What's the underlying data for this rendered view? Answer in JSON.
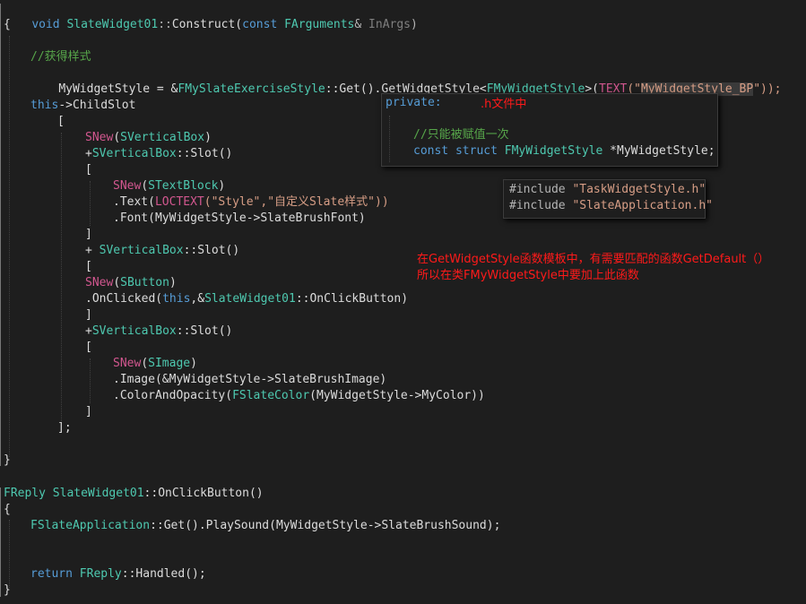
{
  "code": {
    "l1_void": "void",
    "l1_class": "SlateWidget01",
    "l1_sep": "::",
    "l1_fn": "Construct(",
    "l1_const": "const",
    "l1_type": "FArguments",
    "l1_amp": "&",
    "l1_param": "InArgs",
    "l1_close": ")",
    "brace_open": "{",
    "brace_close": "}",
    "comment_style": "//获得样式",
    "l4_var": "MyWidgetStyle = &",
    "l4_cls": "FMySlateExerciseStyle",
    "l4_mid": "::Get().GetWidgetStyle<",
    "l4_tmpl": "FMyWidgetStyle",
    "l4_open": ">(",
    "l4_macro": "TEXT",
    "l4_str_pre": "(\"",
    "l4_str": "MyWidgetStyle_BP",
    "l4_str_post": "\"));",
    "l6_this": "this",
    "l6_rest": "->ChildSlot",
    "bracket_open": "[",
    "bracket_close": "]",
    "bracket_end": "];",
    "snew": "SNew",
    "svb": "SVerticalBox",
    "plus": "+",
    "plus_sp": "+ ",
    "slot": "::Slot()",
    "stextblock": "STextBlock",
    "text_call": ".Text(",
    "loctext": "LOCTEXT",
    "loctext_args": "(\"Style\",\"自定义Slate样式\"))",
    "font_call": ".Font(MyWidgetStyle->SlateBrushFont)",
    "sbutton": "SButton",
    "onclicked": ".OnClicked(",
    "onclicked_this": "this",
    "onclicked_mid": ",&",
    "onclicked_cls": "SlateWidget01",
    "onclicked_end": "::OnClickButton)",
    "simage": "SImage",
    "image_call": ".Image(&MyWidgetStyle->SlateBrushImage)",
    "color_call": ".ColorAndOpacity(",
    "fslatecolor": "FSlateColor",
    "color_args": "(MyWidgetStyle->MyColor))",
    "freply": "FReply",
    "fn2_cls": "SlateWidget01",
    "fn2_name": "::OnClickButton()",
    "fsa": "FSlateApplication",
    "playsound": "::Get().PlaySound(MyWidgetStyle->SlateBrushSound);",
    "return_kw": "return",
    "freply2": "FReply",
    "handled": "::Handled();",
    "paren_open": "(",
    "paren_close": ")"
  },
  "header_popup": {
    "private_label": "private:",
    "file_note": ".h文件中",
    "comment": "//只能被赋值一次",
    "decl_const": "const",
    "decl_struct": "struct",
    "decl_type": "FMyWidgetStyle",
    "decl_var": " *MyWidgetStyle;"
  },
  "include_popup": {
    "inc1_kw": "#include",
    "inc1_file": "\"TaskWidgetStyle.h\"",
    "inc2_kw": "#include",
    "inc2_file": "\"SlateApplication.h\""
  },
  "note": {
    "line1": "在GetWidgetStyle函数模板中，有需要匹配的函数GetDefault（）",
    "line2": "所以在类FMyWidgetStyle中要加上此函数"
  }
}
